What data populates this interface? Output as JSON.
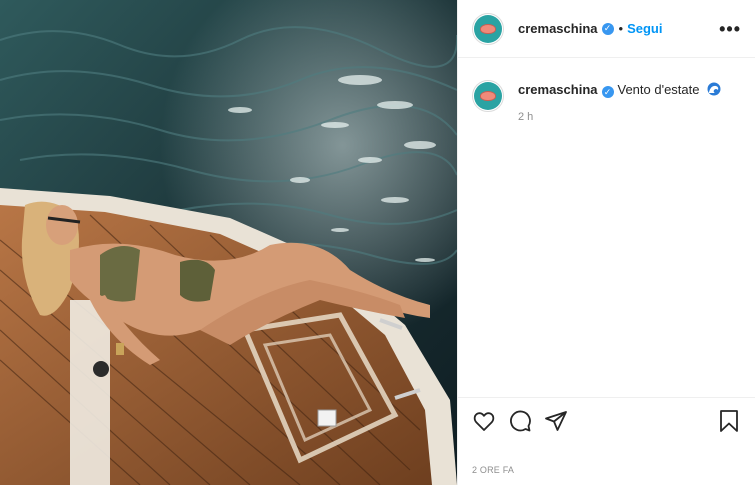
{
  "post": {
    "author": "cremaschina",
    "separator": "•",
    "follow_label": "Segui",
    "more_label": "•••",
    "image_alt": "Woman sunbathing on the wooden deck of a boat over dark sea water",
    "caption": {
      "author": "cremaschina",
      "text": "Vento d'estate",
      "emoji_icon": "wave-icon",
      "time": "2 h"
    },
    "actions": {
      "like_icon": "heart-icon",
      "comment_icon": "comment-icon",
      "share_icon": "paper-plane-icon",
      "save_icon": "bookmark-icon"
    },
    "date_label": "2 ORE FA"
  },
  "colors": {
    "accent": "#0095f6",
    "verified": "#3897f0",
    "text": "#262626",
    "muted": "#8e8e8e"
  }
}
